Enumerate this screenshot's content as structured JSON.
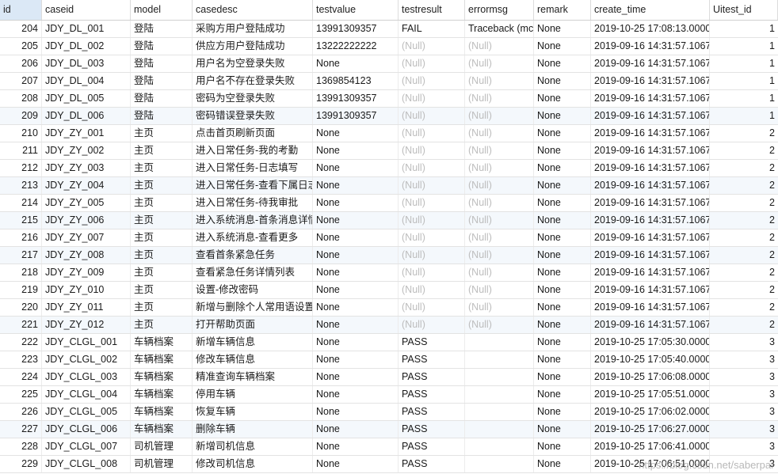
{
  "columns": [
    "id",
    "caseid",
    "model",
    "casedesc",
    "testvalue",
    "testresult",
    "errormsg",
    "remark",
    "create_time",
    "Uitest_id"
  ],
  "rows": [
    [
      "204",
      "JDY_DL_001",
      "登陆",
      "采购方用户登陆成功",
      "13991309357",
      "FAIL",
      "Traceback (mc",
      "None",
      "2019-10-25 17:08:13.0000",
      "1"
    ],
    [
      "205",
      "JDY_DL_002",
      "登陆",
      "供应方用户登陆成功",
      "13222222222",
      "(Null)",
      "(Null)",
      "None",
      "2019-09-16 14:31:57.1067",
      "1"
    ],
    [
      "206",
      "JDY_DL_003",
      "登陆",
      "用户名为空登录失败",
      "None",
      "(Null)",
      "(Null)",
      "None",
      "2019-09-16 14:31:57.1067",
      "1"
    ],
    [
      "207",
      "JDY_DL_004",
      "登陆",
      "用户名不存在登录失败",
      "1369854123",
      "(Null)",
      "(Null)",
      "None",
      "2019-09-16 14:31:57.1067",
      "1"
    ],
    [
      "208",
      "JDY_DL_005",
      "登陆",
      "密码为空登录失败",
      "13991309357",
      "(Null)",
      "(Null)",
      "None",
      "2019-09-16 14:31:57.1067",
      "1"
    ],
    [
      "209",
      "JDY_DL_006",
      "登陆",
      "密码错误登录失败",
      "13991309357",
      "(Null)",
      "(Null)",
      "None",
      "2019-09-16 14:31:57.1067",
      "1"
    ],
    [
      "210",
      "JDY_ZY_001",
      "主页",
      "点击首页刷新页面",
      "None",
      "(Null)",
      "(Null)",
      "None",
      "2019-09-16 14:31:57.1067",
      "2"
    ],
    [
      "211",
      "JDY_ZY_002",
      "主页",
      "进入日常任务-我的考勤",
      "None",
      "(Null)",
      "(Null)",
      "None",
      "2019-09-16 14:31:57.1067",
      "2"
    ],
    [
      "212",
      "JDY_ZY_003",
      "主页",
      "进入日常任务-日志填写",
      "None",
      "(Null)",
      "(Null)",
      "None",
      "2019-09-16 14:31:57.1067",
      "2"
    ],
    [
      "213",
      "JDY_ZY_004",
      "主页",
      "进入日常任务-查看下属日志",
      "None",
      "(Null)",
      "(Null)",
      "None",
      "2019-09-16 14:31:57.1067",
      "2"
    ],
    [
      "214",
      "JDY_ZY_005",
      "主页",
      "进入日常任务-待我审批",
      "None",
      "(Null)",
      "(Null)",
      "None",
      "2019-09-16 14:31:57.1067",
      "2"
    ],
    [
      "215",
      "JDY_ZY_006",
      "主页",
      "进入系统消息-首条消息详情",
      "None",
      "(Null)",
      "(Null)",
      "None",
      "2019-09-16 14:31:57.1067",
      "2"
    ],
    [
      "216",
      "JDY_ZY_007",
      "主页",
      "进入系统消息-查看更多",
      "None",
      "(Null)",
      "(Null)",
      "None",
      "2019-09-16 14:31:57.1067",
      "2"
    ],
    [
      "217",
      "JDY_ZY_008",
      "主页",
      "查看首条紧急任务",
      "None",
      "(Null)",
      "(Null)",
      "None",
      "2019-09-16 14:31:57.1067",
      "2"
    ],
    [
      "218",
      "JDY_ZY_009",
      "主页",
      "查看紧急任务详情列表",
      "None",
      "(Null)",
      "(Null)",
      "None",
      "2019-09-16 14:31:57.1067",
      "2"
    ],
    [
      "219",
      "JDY_ZY_010",
      "主页",
      "设置-修改密码",
      "None",
      "(Null)",
      "(Null)",
      "None",
      "2019-09-16 14:31:57.1067",
      "2"
    ],
    [
      "220",
      "JDY_ZY_011",
      "主页",
      "新增与删除个人常用语设置",
      "None",
      "(Null)",
      "(Null)",
      "None",
      "2019-09-16 14:31:57.1067",
      "2"
    ],
    [
      "221",
      "JDY_ZY_012",
      "主页",
      "打开帮助页面",
      "None",
      "(Null)",
      "(Null)",
      "None",
      "2019-09-16 14:31:57.1067",
      "2"
    ],
    [
      "222",
      "JDY_CLGL_001",
      "车辆档案",
      "新增车辆信息",
      "None",
      "PASS",
      "",
      "None",
      "2019-10-25 17:05:30.0000",
      "3"
    ],
    [
      "223",
      "JDY_CLGL_002",
      "车辆档案",
      "修改车辆信息",
      "None",
      "PASS",
      "",
      "None",
      "2019-10-25 17:05:40.0000",
      "3"
    ],
    [
      "224",
      "JDY_CLGL_003",
      "车辆档案",
      "精准查询车辆档案",
      "None",
      "PASS",
      "",
      "None",
      "2019-10-25 17:06:08.0000",
      "3"
    ],
    [
      "225",
      "JDY_CLGL_004",
      "车辆档案",
      "停用车辆",
      "None",
      "PASS",
      "",
      "None",
      "2019-10-25 17:05:51.0000",
      "3"
    ],
    [
      "226",
      "JDY_CLGL_005",
      "车辆档案",
      "恢复车辆",
      "None",
      "PASS",
      "",
      "None",
      "2019-10-25 17:06:02.0000",
      "3"
    ],
    [
      "227",
      "JDY_CLGL_006",
      "车辆档案",
      "删除车辆",
      "None",
      "PASS",
      "",
      "None",
      "2019-10-25 17:06:27.0000",
      "3"
    ],
    [
      "228",
      "JDY_CLGL_007",
      "司机管理",
      "新增司机信息",
      "None",
      "PASS",
      "",
      "None",
      "2019-10-25 17:06:41.0000",
      "3"
    ],
    [
      "229",
      "JDY_CLGL_008",
      "司机管理",
      "修改司机信息",
      "None",
      "PASS",
      "",
      "None",
      "2019-10-25 17:06:51.0000",
      "3"
    ]
  ],
  "alt_rows": [
    5,
    9,
    11,
    13,
    17,
    23
  ],
  "watermark": "https://blog.csdn.net/saberpai"
}
